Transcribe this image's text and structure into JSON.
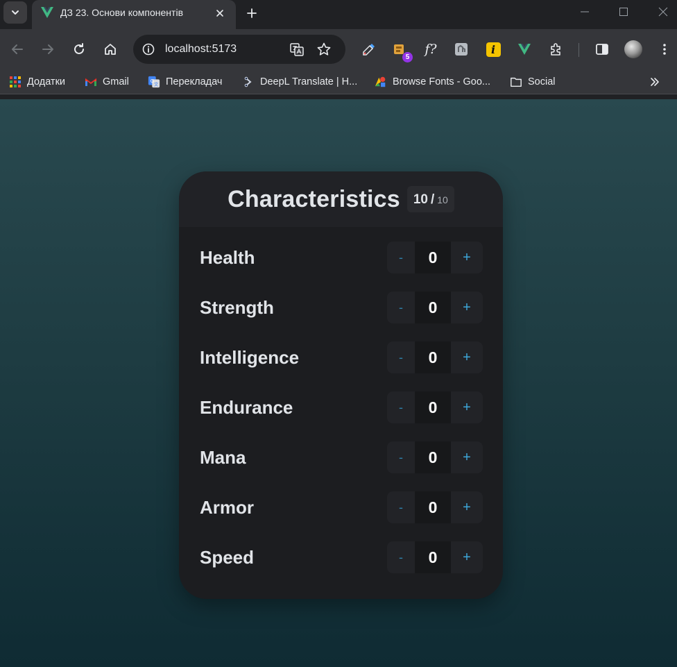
{
  "browser": {
    "tab": {
      "title": "ДЗ 23. Основи компонентів"
    },
    "omnibox": {
      "url": "localhost:5173"
    },
    "extensions": [
      {
        "name": "color-picker-icon"
      },
      {
        "name": "extension-badge-icon",
        "badge": "5"
      },
      {
        "name": "font-finder-icon",
        "label": "f?"
      },
      {
        "name": "screenshot-ext-icon"
      },
      {
        "name": "i-ext-icon",
        "label": "i"
      },
      {
        "name": "vue-devtools-icon"
      },
      {
        "name": "extensions-puzzle-icon"
      }
    ],
    "bookmarks": [
      {
        "label": "Додатки"
      },
      {
        "label": "Gmail"
      },
      {
        "label": "Перекладач"
      },
      {
        "label": "DeepL Translate | H..."
      },
      {
        "label": "Browse Fonts - Goo..."
      },
      {
        "label": "Social"
      }
    ]
  },
  "card": {
    "title": "Characteristics",
    "points": {
      "current": "10",
      "separator": "/",
      "max": "10"
    },
    "stats": [
      {
        "name": "Health",
        "value": "0"
      },
      {
        "name": "Strength",
        "value": "0"
      },
      {
        "name": "Intelligence",
        "value": "0"
      },
      {
        "name": "Endurance",
        "value": "0"
      },
      {
        "name": "Mana",
        "value": "0"
      },
      {
        "name": "Armor",
        "value": "0"
      },
      {
        "name": "Speed",
        "value": "0"
      }
    ],
    "stepper": {
      "minus": "-",
      "plus": "+"
    }
  },
  "colors": {
    "vue_green": "#41b883",
    "accent_blue": "#3da7da",
    "badge_purple": "#9334e6"
  }
}
